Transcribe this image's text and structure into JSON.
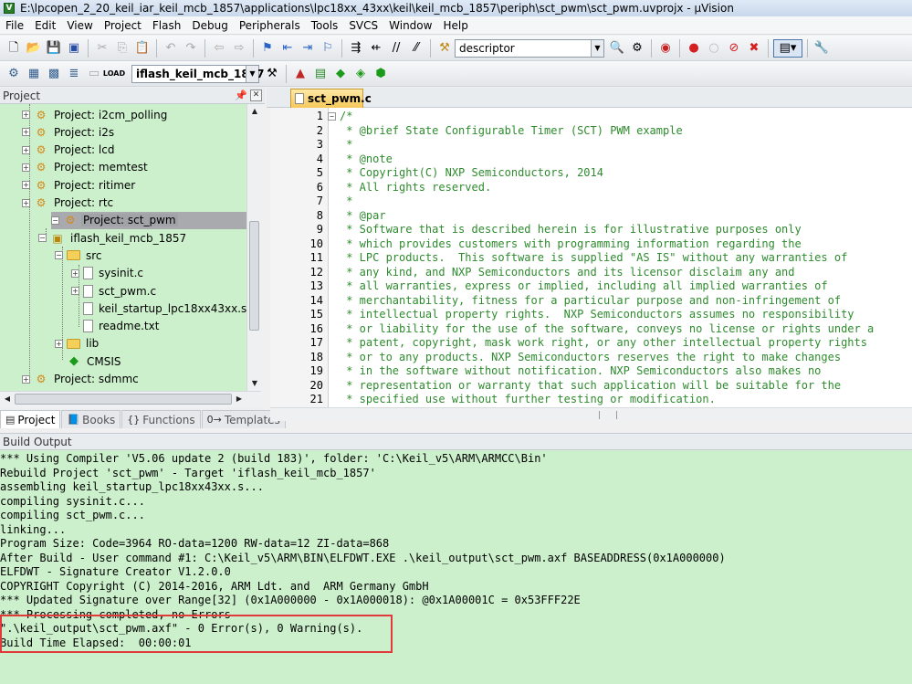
{
  "window": {
    "title": "E:\\lpcopen_2_20_keil_iar_keil_mcb_1857\\applications\\lpc18xx_43xx\\keil\\keil_mcb_1857\\periph\\sct_pwm\\sct_pwm.uvprojx - µVision"
  },
  "menu": [
    "File",
    "Edit",
    "View",
    "Project",
    "Flash",
    "Debug",
    "Peripherals",
    "Tools",
    "SVCS",
    "Window",
    "Help"
  ],
  "toolbar": {
    "find_value": "descriptor",
    "target_value": "iflash_keil_mcb_1857"
  },
  "project_pane": {
    "title": "Project",
    "tree": [
      {
        "label": "Project: i2cm_polling",
        "indent": 0,
        "kind": "project",
        "expander": "+"
      },
      {
        "label": "Project: i2s",
        "indent": 0,
        "kind": "project",
        "expander": "+"
      },
      {
        "label": "Project: lcd",
        "indent": 0,
        "kind": "project",
        "expander": "+"
      },
      {
        "label": "Project: memtest",
        "indent": 0,
        "kind": "project",
        "expander": "+"
      },
      {
        "label": "Project: ritimer",
        "indent": 0,
        "kind": "project",
        "expander": "+"
      },
      {
        "label": "Project: rtc",
        "indent": 0,
        "kind": "project",
        "expander": "+"
      },
      {
        "label": "Project: sct_pwm",
        "indent": 0,
        "kind": "project",
        "expander": "−",
        "selected": true
      },
      {
        "label": "iflash_keil_mcb_1857",
        "indent": 1,
        "kind": "target",
        "expander": "−"
      },
      {
        "label": "src",
        "indent": 2,
        "kind": "folder",
        "expander": "−"
      },
      {
        "label": "sysinit.c",
        "indent": 3,
        "kind": "file",
        "expander": "+"
      },
      {
        "label": "sct_pwm.c",
        "indent": 3,
        "kind": "file",
        "expander": "+"
      },
      {
        "label": "keil_startup_lpc18xx43xx.s",
        "indent": 3,
        "kind": "file",
        "expander": ""
      },
      {
        "label": "readme.txt",
        "indent": 3,
        "kind": "file",
        "expander": ""
      },
      {
        "label": "lib",
        "indent": 2,
        "kind": "folder",
        "expander": "+"
      },
      {
        "label": "CMSIS",
        "indent": 2,
        "kind": "gem",
        "expander": ""
      },
      {
        "label": "Project: sdmmc",
        "indent": 0,
        "kind": "project",
        "expander": "+"
      }
    ],
    "tabs": [
      {
        "label": "Project",
        "icon": "▤",
        "active": true
      },
      {
        "label": "Books",
        "icon": "📘",
        "active": false
      },
      {
        "label": "Functions",
        "icon": "{}",
        "active": false
      },
      {
        "label": "Templates",
        "icon": "0→",
        "active": false
      }
    ]
  },
  "editor": {
    "tab_label": "sct_pwm.c",
    "lines": [
      {
        "n": "1",
        "text": "/*"
      },
      {
        "n": "2",
        "text": " * @brief State Configurable Timer (SCT) PWM example"
      },
      {
        "n": "3",
        "text": " *"
      },
      {
        "n": "4",
        "text": " * @note"
      },
      {
        "n": "5",
        "text": " * Copyright(C) NXP Semiconductors, 2014"
      },
      {
        "n": "6",
        "text": " * All rights reserved."
      },
      {
        "n": "7",
        "text": " *"
      },
      {
        "n": "8",
        "text": " * @par"
      },
      {
        "n": "9",
        "text": " * Software that is described herein is for illustrative purposes only"
      },
      {
        "n": "10",
        "text": " * which provides customers with programming information regarding the"
      },
      {
        "n": "11",
        "text": " * LPC products.  This software is supplied \"AS IS\" without any warranties of"
      },
      {
        "n": "12",
        "text": " * any kind, and NXP Semiconductors and its licensor disclaim any and"
      },
      {
        "n": "13",
        "text": " * all warranties, express or implied, including all implied warranties of"
      },
      {
        "n": "14",
        "text": " * merchantability, fitness for a particular purpose and non-infringement of"
      },
      {
        "n": "15",
        "text": " * intellectual property rights.  NXP Semiconductors assumes no responsibility"
      },
      {
        "n": "16",
        "text": " * or liability for the use of the software, conveys no license or rights under a"
      },
      {
        "n": "17",
        "text": " * patent, copyright, mask work right, or any other intellectual property rights"
      },
      {
        "n": "18",
        "text": " * or to any products. NXP Semiconductors reserves the right to make changes"
      },
      {
        "n": "19",
        "text": " * in the software without notification. NXP Semiconductors also makes no"
      },
      {
        "n": "20",
        "text": " * representation or warranty that such application will be suitable for the"
      },
      {
        "n": "21",
        "text": " * specified use without further testing or modification."
      }
    ]
  },
  "build_output": {
    "title": "Build Output",
    "lines": [
      "*** Using Compiler 'V5.06 update 2 (build 183)', folder: 'C:\\Keil_v5\\ARM\\ARMCC\\Bin'",
      "Rebuild Project 'sct_pwm' - Target 'iflash_keil_mcb_1857'",
      "assembling keil_startup_lpc18xx43xx.s...",
      "compiling sysinit.c...",
      "compiling sct_pwm.c...",
      "linking...",
      "Program Size: Code=3964 RO-data=1200 RW-data=12 ZI-data=868",
      "After Build - User command #1: C:\\Keil_v5\\ARM\\BIN\\ELFDWT.EXE .\\keil_output\\sct_pwm.axf BASEADDRESS(0x1A000000)",
      "ELFDWT - Signature Creator V1.2.0.0",
      "COPYRIGHT Copyright (C) 2014-2016, ARM Ldt. and  ARM Germany GmbH",
      "*** Updated Signature over Range[32] (0x1A000000 - 0x1A000018): @0x1A00001C = 0x53FFF22E",
      "*** Processing completed, no Errors",
      "\".\\keil_output\\sct_pwm.axf\" - 0 Error(s), 0 Warning(s).",
      "Build Time Elapsed:  00:00:01"
    ]
  }
}
